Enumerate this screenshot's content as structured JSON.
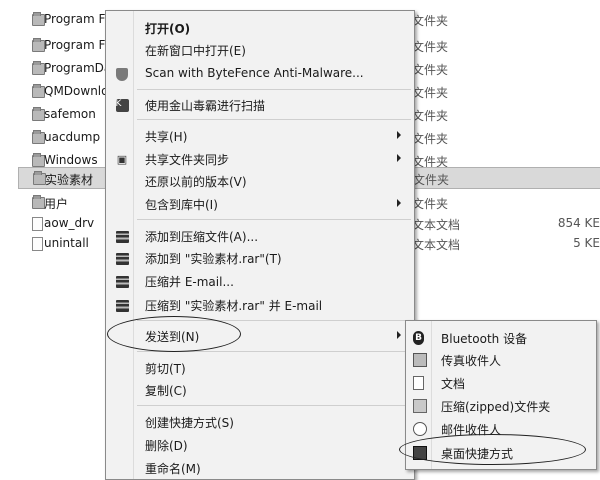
{
  "files": [
    {
      "name": "Program Fi",
      "type": "文件夹",
      "size": "",
      "icon": "folder-icon"
    },
    {
      "name": "Program Fi",
      "type": "文件夹",
      "size": "",
      "icon": "folder-icon"
    },
    {
      "name": "ProgramDa",
      "type": "文件夹",
      "size": "",
      "icon": "folder-icon"
    },
    {
      "name": "QMDownlo",
      "type": "文件夹",
      "size": "",
      "icon": "folder-icon"
    },
    {
      "name": "safemon",
      "type": "文件夹",
      "size": "",
      "icon": "folder-icon"
    },
    {
      "name": "uacdump",
      "type": "文件夹",
      "size": "",
      "icon": "folder-icon"
    },
    {
      "name": "Windows",
      "type": "文件夹",
      "size": "",
      "icon": "folder-icon"
    },
    {
      "name": "实验素材",
      "type": "文件夹",
      "size": "",
      "icon": "folder-icon",
      "selected": true
    },
    {
      "name": "用户",
      "type": "文件夹",
      "size": "",
      "icon": "folder-icon"
    },
    {
      "name": "aow_drv",
      "type": "文本文档",
      "size": "854 KE",
      "icon": "text-file-icon"
    },
    {
      "name": "unintall",
      "type": "文本文档",
      "size": "5 KE",
      "icon": "text-file-icon"
    }
  ],
  "context_menu": {
    "open": "打开(O)",
    "open_new_window": "在新窗口中打开(E)",
    "scan_bytefence": "Scan with ByteFence Anti-Malware...",
    "scan_kingsoft": "使用金山毒霸进行扫描",
    "share": "共享(H)",
    "share_sync": "共享文件夹同步",
    "restore_previous": "还原以前的版本(V)",
    "include_in_library": "包含到库中(I)",
    "add_to_archive": "添加到压缩文件(A)...",
    "add_to_rar": "添加到 \"实验素材.rar\"(T)",
    "compress_email": "压缩并 E-mail...",
    "compress_rar_email": "压缩到 \"实验素材.rar\" 并 E-mail",
    "send_to": "发送到(N)",
    "cut": "剪切(T)",
    "copy": "复制(C)",
    "create_shortcut": "创建快捷方式(S)",
    "delete": "删除(D)",
    "rename": "重命名(M)"
  },
  "send_to_menu": {
    "bluetooth": "Bluetooth 设备",
    "fax_recipient": "传真收件人",
    "documents": "文档",
    "zipped_folder": "压缩(zipped)文件夹",
    "mail_recipient": "邮件收件人",
    "desktop_shortcut": "桌面快捷方式"
  }
}
